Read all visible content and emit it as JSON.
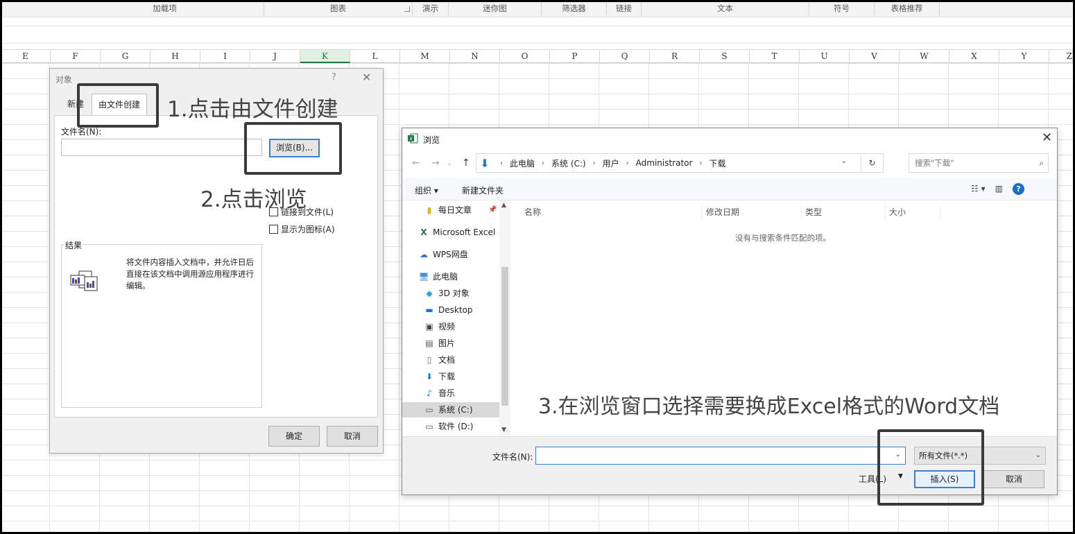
{
  "ribbon": {
    "groups": [
      "加载项",
      "图表",
      "演示",
      "迷你图",
      "筛选器",
      "链接",
      "文本",
      "符号",
      "表格推荐"
    ]
  },
  "columns": [
    "E",
    "F",
    "G",
    "H",
    "I",
    "J",
    "K",
    "L",
    "M",
    "N",
    "O",
    "P",
    "Q",
    "R",
    "S",
    "T",
    "U",
    "V",
    "W",
    "X",
    "Y",
    "Z"
  ],
  "selected_column": "K",
  "object_dialog": {
    "title": "对象",
    "help": "?",
    "close": "✕",
    "tabs": [
      "新建",
      "由文件创建"
    ],
    "filename_label": "文件名(N):",
    "filename_value": "",
    "browse_label": "浏览(B)...",
    "link_label": "链接到文件(L)",
    "icon_label": "显示为图标(A)",
    "result_label": "结果",
    "result_text": "将文件内容插入文档中，并允许日后直接在该文档中调用源应用程序进行编辑。",
    "ok_label": "确定",
    "cancel_label": "取消"
  },
  "browse_dialog": {
    "title": "浏览",
    "close": "✕",
    "breadcrumb": [
      "此电脑",
      "系统 (C:)",
      "用户",
      "Administrator",
      "下载"
    ],
    "search_placeholder": "搜索\"下载\"",
    "organize_label": "组织 ▾",
    "new_folder_label": "新建文件夹",
    "nav_items": [
      {
        "label": "每日文章",
        "icon": "folder-icon"
      },
      {
        "label": "Microsoft Excel",
        "icon": "excel-icon"
      },
      {
        "label": "WPS网盘",
        "icon": "cloud-icon"
      },
      {
        "label": "此电脑",
        "icon": "computer-icon"
      },
      {
        "label": "3D 对象",
        "icon": "cube-icon"
      },
      {
        "label": "Desktop",
        "icon": "desktop-icon"
      },
      {
        "label": "视频",
        "icon": "video-icon"
      },
      {
        "label": "图片",
        "icon": "picture-icon"
      },
      {
        "label": "文档",
        "icon": "document-icon"
      },
      {
        "label": "下载",
        "icon": "download-icon"
      },
      {
        "label": "音乐",
        "icon": "music-icon"
      },
      {
        "label": "系统 (C:)",
        "icon": "drive-icon"
      },
      {
        "label": "软件 (D:)",
        "icon": "drive-icon"
      }
    ],
    "columns": [
      "名称",
      "修改日期",
      "类型",
      "大小"
    ],
    "empty_text": "没有与搜索条件匹配的项。",
    "filename_label": "文件名(N):",
    "filename_value": "",
    "filter_value": "所有文件(*.*)",
    "tools_label": "工具(L)",
    "insert_label": "插入(S)",
    "cancel_label": "取消"
  },
  "annotations": {
    "step1": "1.点击由文件创建",
    "step2": "2.点击浏览",
    "step3": "3.在浏览窗口选择需要换成Excel格式的Word文档"
  }
}
